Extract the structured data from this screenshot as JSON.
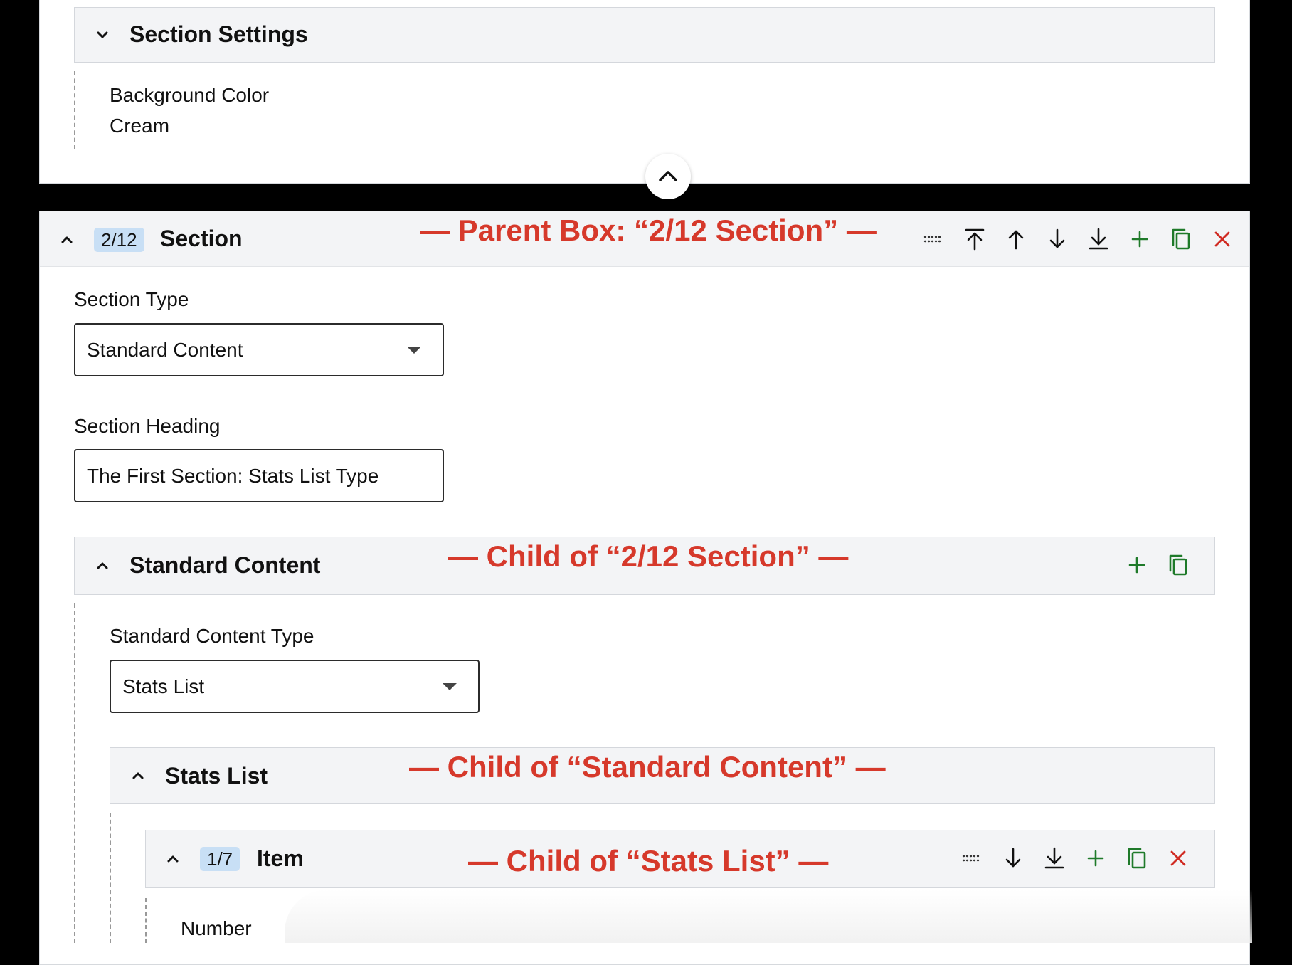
{
  "section_settings": {
    "title": "Section Settings",
    "background_color_label": "Background Color",
    "background_color_value": "Cream"
  },
  "section_box": {
    "badge": "2/12",
    "title": "Section",
    "annotation": "— Parent Box: “2/12 Section” —",
    "section_type_label": "Section Type",
    "section_type_value": "Standard Content",
    "section_heading_label": "Section Heading",
    "section_heading_value": "The First Section: Stats List Type"
  },
  "standard_content": {
    "title": "Standard Content",
    "annotation": "— Child of “2/12 Section” —",
    "type_label": "Standard Content Type",
    "type_value": "Stats List"
  },
  "stats_list": {
    "title": "Stats List",
    "annotation": "— Child of “Standard Content” —"
  },
  "item": {
    "badge": "1/7",
    "title": "Item",
    "annotation": "— Child of “Stats List” —",
    "number_label": "Number"
  },
  "colors": {
    "annotation": "#d6392b",
    "add_copy": "#1f7a2a",
    "remove": "#d02a22",
    "badge_bg": "#c8dff5",
    "header_bg": "#f3f4f6"
  }
}
